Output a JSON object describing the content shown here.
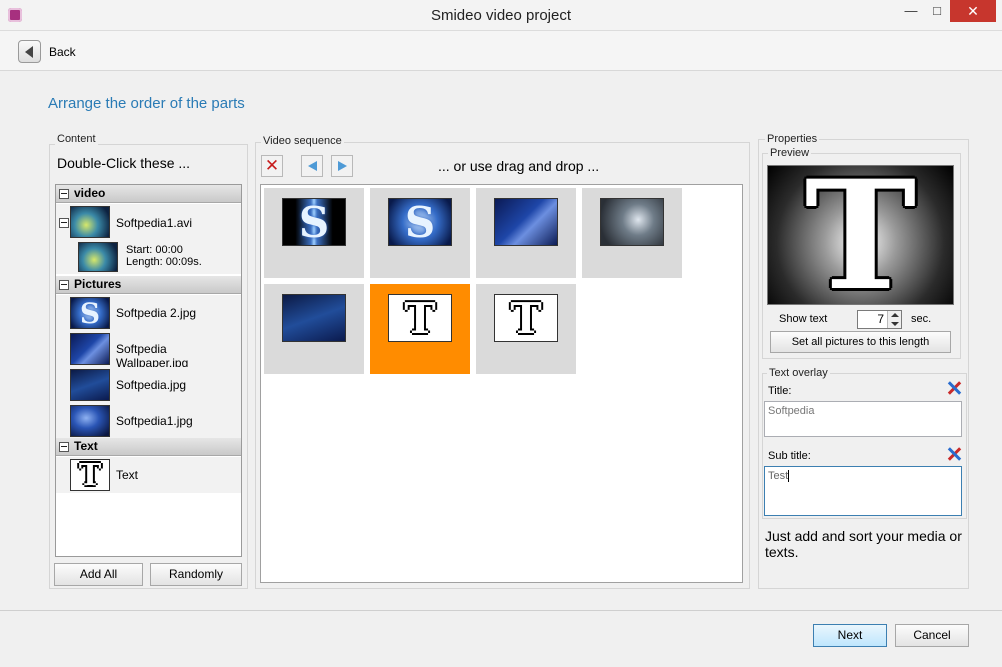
{
  "window": {
    "title": "Smideo video project"
  },
  "nav": {
    "back_label": "Back"
  },
  "page": {
    "heading": "Arrange the order of the parts"
  },
  "content": {
    "group_label": "Content",
    "hint": "Double-Click these ...",
    "categories": {
      "video": {
        "label": "video",
        "item": {
          "label": "Softpedia1.avi",
          "start": "Start:     00:00",
          "length": "Length: 00:09s."
        }
      },
      "pictures": {
        "label": "Pictures",
        "items": [
          {
            "label": "Softpedia 2.jpg"
          },
          {
            "label": "Softpedia Wallpaper.jpg"
          },
          {
            "label": "Softpedia.jpg"
          },
          {
            "label": "Softpedia1.jpg"
          }
        ]
      },
      "text": {
        "label": "Text",
        "item": {
          "label": "Text",
          "glyph": "T"
        }
      }
    },
    "add_all_label": "Add All",
    "randomly_label": "Randomly"
  },
  "sequence": {
    "group_label": "Video sequence",
    "hint": "... or use drag and drop ...",
    "thumb_glyph": "S",
    "text_glyph": "T"
  },
  "properties": {
    "group_label": "Properties",
    "preview_label": "Preview",
    "preview_glyph": "T",
    "show_text_label": "Show text",
    "show_text_value": "7",
    "sec_label": "sec.",
    "set_all_label": "Set all pictures to this length",
    "overlay_label": "Text overlay",
    "title_label": "Title:",
    "title_value": "Softpedia",
    "subtitle_label": "Sub title:",
    "subtitle_value": "Test",
    "info": "Just add and sort your media or texts."
  },
  "footer": {
    "next_label": "Next",
    "cancel_label": "Cancel"
  },
  "colors": {
    "accent": "#2a7bb5",
    "selection": "#ff8c00",
    "close": "#c7362d"
  }
}
